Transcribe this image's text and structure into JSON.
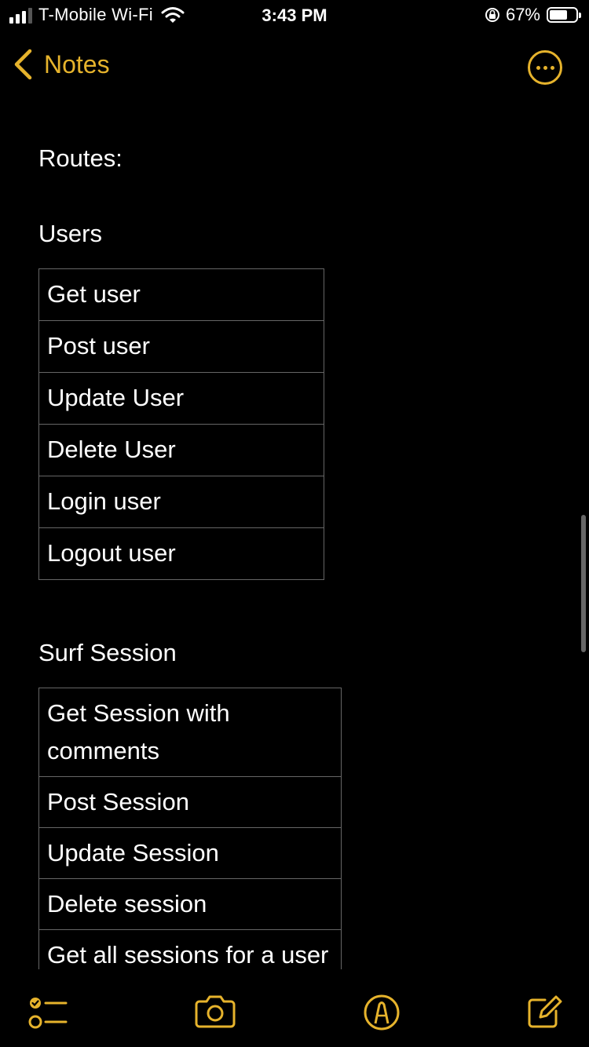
{
  "status_bar": {
    "carrier": "T-Mobile Wi-Fi",
    "time": "3:43 PM",
    "battery_percent": "67%",
    "battery_level": 0.67,
    "signal_bars": 3,
    "icons": [
      "signal-icon",
      "wifi-icon",
      "orientation-lock-icon",
      "battery-icon"
    ]
  },
  "nav": {
    "back_label": "Notes",
    "back_icon": "chevron-left-icon",
    "more_icon": "ellipsis-circle-icon"
  },
  "note": {
    "heading": "Routes:",
    "users": {
      "title": "Users",
      "rows": [
        "Get user",
        "Post user",
        "Update User",
        "Delete User",
        "Login user",
        "Logout user"
      ]
    },
    "surf_session": {
      "title": "Surf Session",
      "rows": [
        "Get Session with comments",
        "Post Session",
        "Update Session",
        "Delete session",
        "Get all sessions for a user with comments"
      ]
    }
  },
  "toolbar": {
    "icons": [
      "checklist-icon",
      "camera-icon",
      "markup-icon",
      "compose-icon"
    ]
  },
  "colors": {
    "accent": "#e6b32c",
    "background": "#000000",
    "text": "#ffffff",
    "table_border": "#666666"
  }
}
